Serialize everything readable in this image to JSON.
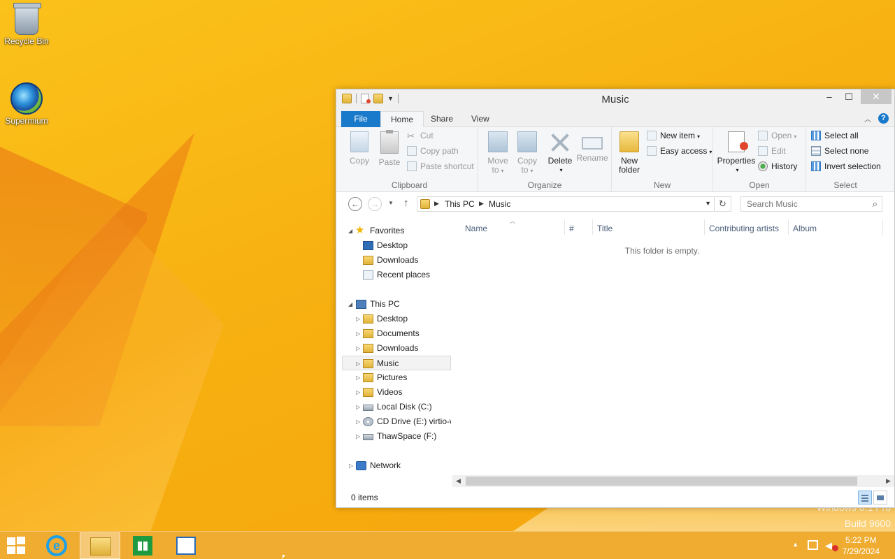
{
  "desktop": {
    "icons": [
      {
        "label": "Recycle Bin",
        "icon": "recycle-bin-icon"
      },
      {
        "label": "Supermium",
        "icon": "supermium-browser-icon"
      }
    ],
    "watermark": {
      "line1": "Windows 8.1 Pro",
      "line2": "Build 9600"
    }
  },
  "window": {
    "title": "Music",
    "controls": {
      "minimize": "–",
      "maximize": "☐",
      "close": "✕"
    }
  },
  "ribbon": {
    "tabs": [
      {
        "label": "File"
      },
      {
        "label": "Home"
      },
      {
        "label": "Share"
      },
      {
        "label": "View"
      }
    ],
    "help": "?",
    "groups": {
      "clipboard": {
        "label": "Clipboard",
        "copy": "Copy",
        "paste": "Paste",
        "cut": "Cut",
        "copy_path": "Copy path",
        "paste_shortcut": "Paste shortcut"
      },
      "organize": {
        "label": "Organize",
        "move_to_1": "Move",
        "move_to_2": "to",
        "copy_to_1": "Copy",
        "copy_to_2": "to",
        "delete": "Delete",
        "rename": "Rename"
      },
      "new": {
        "label": "New",
        "new_folder_1": "New",
        "new_folder_2": "folder",
        "new_item": "New item",
        "easy_access": "Easy access"
      },
      "open": {
        "label": "Open",
        "properties": "Properties",
        "open": "Open",
        "edit": "Edit",
        "history": "History"
      },
      "select": {
        "label": "Select",
        "select_all": "Select all",
        "select_none": "Select none",
        "invert_selection": "Invert selection"
      }
    }
  },
  "address": {
    "crumbs": [
      "This PC",
      "Music"
    ],
    "search_placeholder": "Search Music"
  },
  "nav_pane": {
    "favorites": {
      "label": "Favorites",
      "items": [
        "Desktop",
        "Downloads",
        "Recent places"
      ]
    },
    "this_pc": {
      "label": "This PC",
      "items": [
        "Desktop",
        "Documents",
        "Downloads",
        "Music",
        "Pictures",
        "Videos",
        "Local Disk (C:)",
        "CD Drive (E:) virtio-w",
        "ThawSpace (F:)"
      ]
    },
    "network": {
      "label": "Network"
    }
  },
  "content": {
    "columns": [
      "Name",
      "#",
      "Title",
      "Contributing artists",
      "Album"
    ],
    "empty_message": "This folder is empty."
  },
  "status": {
    "item_count": "0 items"
  },
  "taskbar": {
    "clock_time": "5:22 PM",
    "clock_date": "7/29/2024"
  },
  "colors": {
    "accent": "#1979ca",
    "wallpaper": "#f7b513"
  }
}
